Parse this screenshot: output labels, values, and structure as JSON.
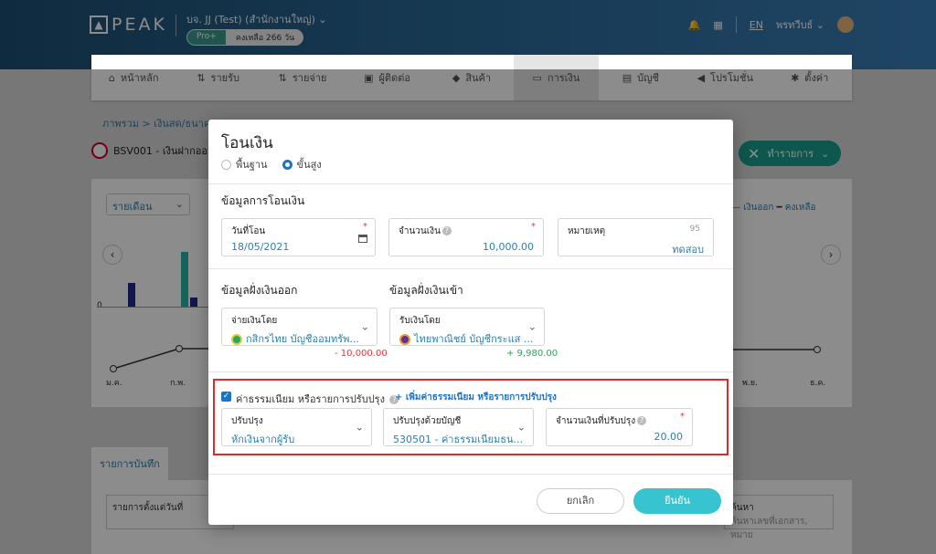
{
  "header": {
    "logo": "PEAK",
    "company": "บจ. JJ (Test) (สำนักงานใหญ่)",
    "plan": "Pro+",
    "days_left": "คงเหลือ 266 วัน",
    "language": "EN",
    "user": "พรทวีบธ์"
  },
  "nav": {
    "items": [
      {
        "label": "หน้าหลัก",
        "icon": "home-icon"
      },
      {
        "label": "รายรับ",
        "icon": "income-icon"
      },
      {
        "label": "รายจ่าย",
        "icon": "expense-icon"
      },
      {
        "label": "ผู้ติดต่อ",
        "icon": "contact-icon"
      },
      {
        "label": "สินค้า",
        "icon": "product-icon"
      },
      {
        "label": "การเงิน",
        "icon": "money-icon",
        "active": true
      },
      {
        "label": "บัญชี",
        "icon": "book-icon"
      },
      {
        "label": "โปรโมชั่น",
        "icon": "megaphone-icon"
      },
      {
        "label": "ตั้งค่า",
        "icon": "gear-icon"
      }
    ]
  },
  "background": {
    "breadcrumb": "ภาพรวม > เงินสด/ธนาคาร",
    "account_name": "BSV001 - เงินฝากออมท",
    "action_button": "ทำรายการ",
    "period_select": "รายเดือน",
    "legend_out": "เงินออก",
    "legend_balance": "คงเหลือ",
    "axis_zero": "0",
    "month_labels": [
      "ม.ค.",
      "ก.พ.",
      "พ.ย.",
      "ธ.ค."
    ],
    "records_tab": "รายการบันทึก",
    "record_field_label": "รายการตั้งแต่วันที่",
    "right_field_label": "ค้นหา",
    "right_field_placeholder": "ค้นหาเลขที่เอกสาร, หมาย"
  },
  "modal": {
    "title": "โอนเงิน",
    "mode_basic": "พื้นฐาน",
    "mode_advanced": "ขั้นสูง",
    "transfer_info_title": "ข้อมูลการโอนเงิน",
    "date_label": "วันที่โอน",
    "date_value": "18/05/2021",
    "amount_label": "จำนวนเงิน",
    "amount_value": "10,000.00",
    "note_label": "หมายเหตุ",
    "note_counter": "95",
    "note_value": "ทดสอบ",
    "out_title": "ข้อมูลฝั่งเงินออก",
    "in_title": "ข้อมูลฝั่งเงินเข้า",
    "pay_by_label": "จ่ายเงินโดย",
    "pay_by_value": "กสิกรไทย บัญชีออมทรัพ...",
    "pay_amount": "- 10,000.00",
    "receive_by_label": "รับเงินโดย",
    "receive_by_value": "ไทยพาณิชย์ บัญชีกระแส ...",
    "receive_amount": "+ 9,980.00",
    "fee_checkbox_label": "ค่าธรรมเนียม หรือรายการปรับปรุง",
    "fee_add_link": "+ เพิ่มค่าธรรมเนียม หรือรายการปรับปรุง",
    "adjust_label": "ปรับปรุง",
    "adjust_value": "หักเงินจากผู้รับ",
    "adjust_account_label": "ปรับปรุงด้วยบัญชี",
    "adjust_account_value": "530501 - ค่าธรรมเนียมธน...",
    "adjust_amount_label": "จำนวนเงินที่ปรับปรุง",
    "adjust_amount_value": "20.00",
    "cancel": "ยกเลิก",
    "confirm": "ยืนยัน"
  },
  "colors": {
    "accent": "#1a73c8",
    "confirm": "#38c3d0",
    "highlight": "#d92c2c",
    "negative": "#e33333",
    "positive": "#2ea55a"
  }
}
